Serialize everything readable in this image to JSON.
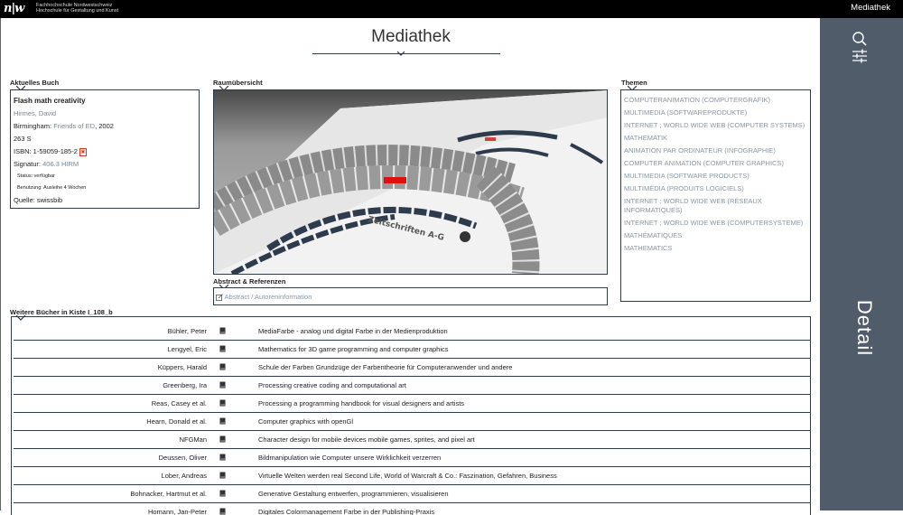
{
  "topbar": {
    "logo": "n|w",
    "org_line1": "Fachhochschule Nordwestschweiz",
    "org_line2": "Hochschule für Gestaltung und Kunst",
    "app_name": "Mediathek"
  },
  "page": {
    "title": "Mediathek"
  },
  "sidebar": {
    "detail_label": "Detail",
    "icons": [
      "search-icon",
      "filter-sliders-icon"
    ]
  },
  "current_book": {
    "section_label": "Aktuelles Buch",
    "title": "Flash math creativity",
    "author": "Hirmes, David",
    "place": "Birmingham:",
    "publisher": "Friends of ED",
    "year": ", 2002",
    "pages": "263 S",
    "isbn": "ISBN: 1-59059-185-2",
    "signature_label": "Signatur:",
    "signature": "406.3 HIRM",
    "status": "Status: verfügbar",
    "loan": "Benutzung: Ausleihe 4 Wochen",
    "source": "Quelle: swissbib"
  },
  "shelf_view": {
    "section_label": "Raumübersicht",
    "shelf_label": "Zeitschriften A-G"
  },
  "themes": {
    "section_label": "Themen",
    "items": [
      "COMPUTERANIMATION (COMPUTERGRAFIK)",
      "MULTIMEDIA (SOFTWAREPRODUKTE)",
      "INTERNET ; WORLD WIDE WEB (COMPUTER SYSTEMS)",
      "MATHEMATIK",
      "ANIMATION PAR ORDINATEUR (INFOGRAPHIE)",
      "COMPUTER ANIMATION (COMPUTER GRAPHICS)",
      "MULTIMEDIA (SOFTWARE PRODUCTS)",
      "MULTIMÉDIA (PRODUITS LOGICIELS)",
      "INTERNET ; WORLD WIDE WEB (RÉSEAUX INFORMATIQUES)",
      "INTERNET ; WORLD WIDE WEB (COMPUTERSYSTEME)",
      "MATHÉMATIQUES",
      "MATHEMATICS"
    ]
  },
  "abstract": {
    "section_label": "Abstract & Referenzen",
    "link_text": "Abstract / Autoreninformation"
  },
  "more_books": {
    "section_label": "Weitere Bücher in Kiste I_108_b",
    "rows": [
      {
        "author": "Bühler, Peter",
        "title": "MediaFarbe - analog und digital Farbe in der Medienproduktion"
      },
      {
        "author": "Lengyel, Eric",
        "title": "Mathematics for 3D game programming and computer graphics"
      },
      {
        "author": "Küppers, Harald",
        "title": "Schule der Farben Grundzüge der Farbentheorie für Computeranwender und andere"
      },
      {
        "author": "Greenberg, Ira",
        "title": "Processing creative coding and computational art"
      },
      {
        "author": "Reas, Casey et al.",
        "title": "Processing a programming handbook for visual designers and artists"
      },
      {
        "author": "Hearn, Donald et al.",
        "title": "Computer graphics with openGl"
      },
      {
        "author": "NFGMan",
        "title": "Character design for mobile devices mobile games, sprites, and pixel art"
      },
      {
        "author": "Deussen, Oliver",
        "title": "Bildmanipulation wie Computer unsere Wirklichkeit verzerren"
      },
      {
        "author": "Lober, Andreas",
        "title": "Virtuelle Welten werden real Second Life, World of Warcraft & Co.: Faszination, Gefahren, Business"
      },
      {
        "author": "Bohnacker, Hartmut et al.",
        "title": "Generative Gestaltung entwerfen, programmieren, visualisieren"
      },
      {
        "author": "Homann, Jan-Peter",
        "title": "Digitales Colormanagement Farbe in der Publishing-Praxis"
      }
    ]
  },
  "colors": {
    "accent": "#2d3b4e",
    "sidebar": "#505c6a",
    "highlight": "#e01010"
  }
}
